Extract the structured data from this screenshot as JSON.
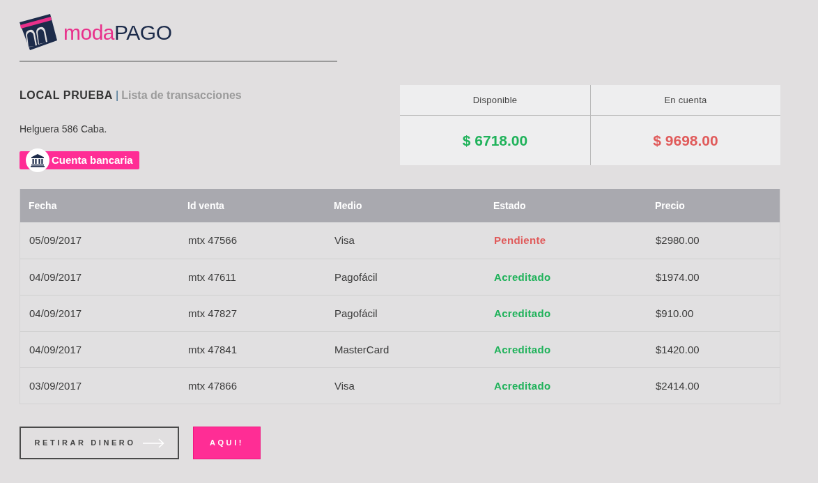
{
  "logo": {
    "wordmark_parts": [
      "moda",
      "PAGO"
    ]
  },
  "header": {
    "store_name": "LOCAL PRUEBA",
    "separator": "|",
    "page_title": "Lista de transacciones",
    "address": "Helguera 586 Caba.",
    "badge": "Cuenta bancaria"
  },
  "balances": [
    {
      "label": "Disponible",
      "amount": "$ 6718.00",
      "color": "#1fb25a"
    },
    {
      "label": "En cuenta",
      "amount": "$ 9698.00",
      "color": "#e05a5a"
    }
  ],
  "table": {
    "columns": [
      "Fecha",
      "Id venta",
      "Medio",
      "Estado",
      "Precio"
    ],
    "rows": [
      {
        "date": "05/09/2017",
        "sale_id": "mtx 47566",
        "method": "Visa",
        "status": "Pendiente",
        "color": "#e05a5a",
        "price": "$2980.00"
      },
      {
        "date": "04/09/2017",
        "sale_id": "mtx 47611",
        "method": "Pagofácil",
        "status": "Acreditado",
        "color": "#1fb25a",
        "price": "$1974.00"
      },
      {
        "date": "04/09/2017",
        "sale_id": "mtx 47827",
        "method": "Pagofácil",
        "status": "Acreditado",
        "color": "#1fb25a",
        "price": "$910.00"
      },
      {
        "date": "04/09/2017",
        "sale_id": "mtx 47841",
        "method": "MasterCard",
        "status": "Acreditado",
        "color": "#1fb25a",
        "price": "$1420.00"
      },
      {
        "date": "03/09/2017",
        "sale_id": "mtx 47866",
        "method": "Visa",
        "status": "Acreditado",
        "color": "#1fb25a",
        "price": "$2414.00"
      }
    ]
  },
  "buttons": [
    {
      "label": "RETIRAR DINERO",
      "kind": "outline"
    },
    {
      "label": "AQUI!",
      "kind": "primary"
    }
  ]
}
